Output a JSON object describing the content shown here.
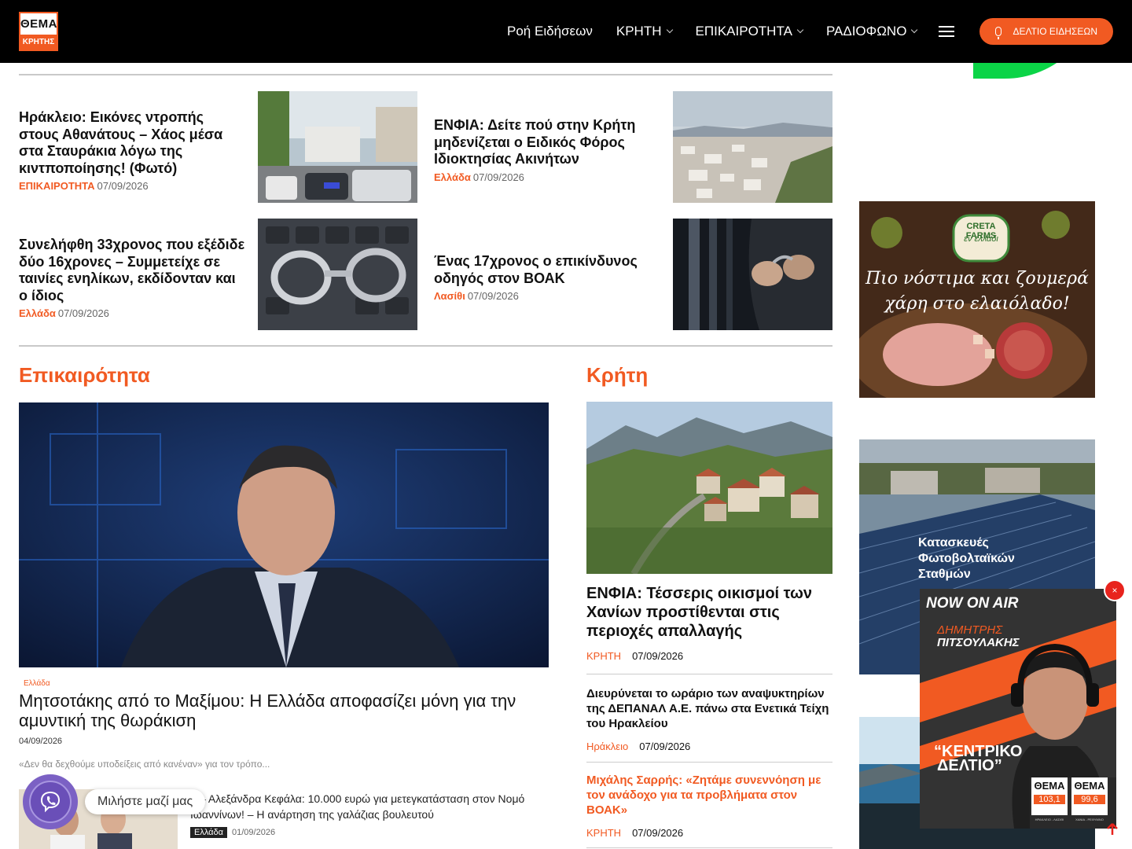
{
  "header": {
    "logo_top": "ΘΕΜΑ",
    "logo_bottom": "ΚΡΗΤΗΣ",
    "nav": [
      "Ροή Ειδήσεων",
      "ΚΡΗΤΗ",
      "ΕΠΙΚΑΙΡΟΤΗΤΑ",
      "ΡΑΔΙΟΦΩΝΟ"
    ],
    "news_button": "ΔΕΛΤΙΟ ΕΙΔΗΣΕΩΝ"
  },
  "top_stories": [
    {
      "title": "Ηράκλειο: Εικόνες ντροπής στους Αθανάτους – Χάος μέσα στα Σταυράκια λόγω της κιντποποίησης! (Φωτό)",
      "category": "ΕΠΙΚΑΙΡΟΤΗΤΑ",
      "date": "07/09/2026"
    },
    {
      "title": "ΕΝΦΙΑ: Δείτε πού στην Κρήτη μηδενίζεται ο Ειδικός Φόρος Ιδιοκτησίας Ακινήτων",
      "category": "Ελλάδα",
      "date": "07/09/2026"
    },
    {
      "title": "Συνελήφθη 33χρονος που εξέδιδε δύο 16χρονες – Συμμετείχε σε ταινίες ενηλίκων, εκδίδονταν και ο ίδιος",
      "category": "Ελλάδα",
      "date": "07/09/2026"
    },
    {
      "title": "Ένας 17χρονος ο επικίνδυνος οδηγός στον ΒΟΑΚ",
      "category": "Λασίθι",
      "date": "07/09/2026"
    }
  ],
  "epikairotita": {
    "heading": "Επικαιρότητα",
    "main": {
      "category": "Ελλάδα",
      "title": "Μητσοτάκης από το Μαξίμου: Η Ελλάδα αποφασίζει μόνη για την αμυντική της θωράκιση",
      "date": "04/09/2026",
      "excerpt": "«Δεν θα δεχθούμε υποδείξεις από κανέναν» για τον τρόπο..."
    },
    "second": {
      "title": "α – Αλεξάνδρα Κεφάλα: 10.000 ευρώ για μετεγκατάσταση στον Νομό Ιωαννίνων! – Η ανάρτηση της γαλάζιας βουλευτού",
      "category": "Ελλάδα",
      "date": "01/09/2026"
    }
  },
  "kriti": {
    "heading": "Κρήτη",
    "main": {
      "title": "ΕΝΦΙΑ: Τέσσερις οικισμοί των Χανίων προστίθενται στις περιοχές απαλλαγής",
      "category": "ΚΡΗΤΗ",
      "date": "07/09/2026"
    },
    "items": [
      {
        "title": "Διευρύνεται το ωράριο των αναψυκτηρίων της ΔΕΠΑΝΑΛ Α.Ε. πάνω στα Ενετικά Τείχη του Ηρακλείου",
        "category": "Ηράκλειο",
        "date": "07/09/2026"
      },
      {
        "title": "Μιχάλης Σαρρής: «Ζητάμε συνεννόηση με τον ανάδοχο για τα προβλήματα στον ΒΟΑΚ»",
        "category": "ΚΡΗΤΗ",
        "date": "07/09/2026"
      }
    ]
  },
  "ads": {
    "creta_brand": "CRETA FARMS",
    "creta_sub": "εν ελλάδι",
    "creta_slogan_1": "Πιο νόστιμα και ζουμερά",
    "creta_slogan_2": "χάρη στο ελαιόλαδο!",
    "solar_text_1": "Κατασκευές",
    "solar_text_2": "Φωτοβολταϊκών",
    "solar_text_3": "Σταθμών"
  },
  "chat": {
    "label": "Μιλήστε μαζί μας"
  },
  "onair": {
    "label": "NOW ON AIR",
    "host_first": "ΔΗΜΗΤΡΗΣ",
    "host_last": "ΠΙΤΣΟΥΛΑΚΗΣ",
    "show_1": "“ΚΕΝΤΡΙΚΟ",
    "show_2": "ΔΕΛΤΙΟ”",
    "station1_name": "ΘΕΜΑ",
    "station1_freq": "103,1",
    "station2_name": "ΘΕΜΑ",
    "station2_freq": "99,6",
    "station1_area": "ΗΡΑΚΛΕΙΟ - ΛΑΣΙΘΙ",
    "station2_area": "ΧΑΝΙΑ - ΡΕΘΥΜΝΟ",
    "close": "×"
  },
  "colors": {
    "accent": "#f15a22",
    "header_bg": "#000000",
    "viber": "#7b61c4",
    "green": "#0bd447"
  }
}
